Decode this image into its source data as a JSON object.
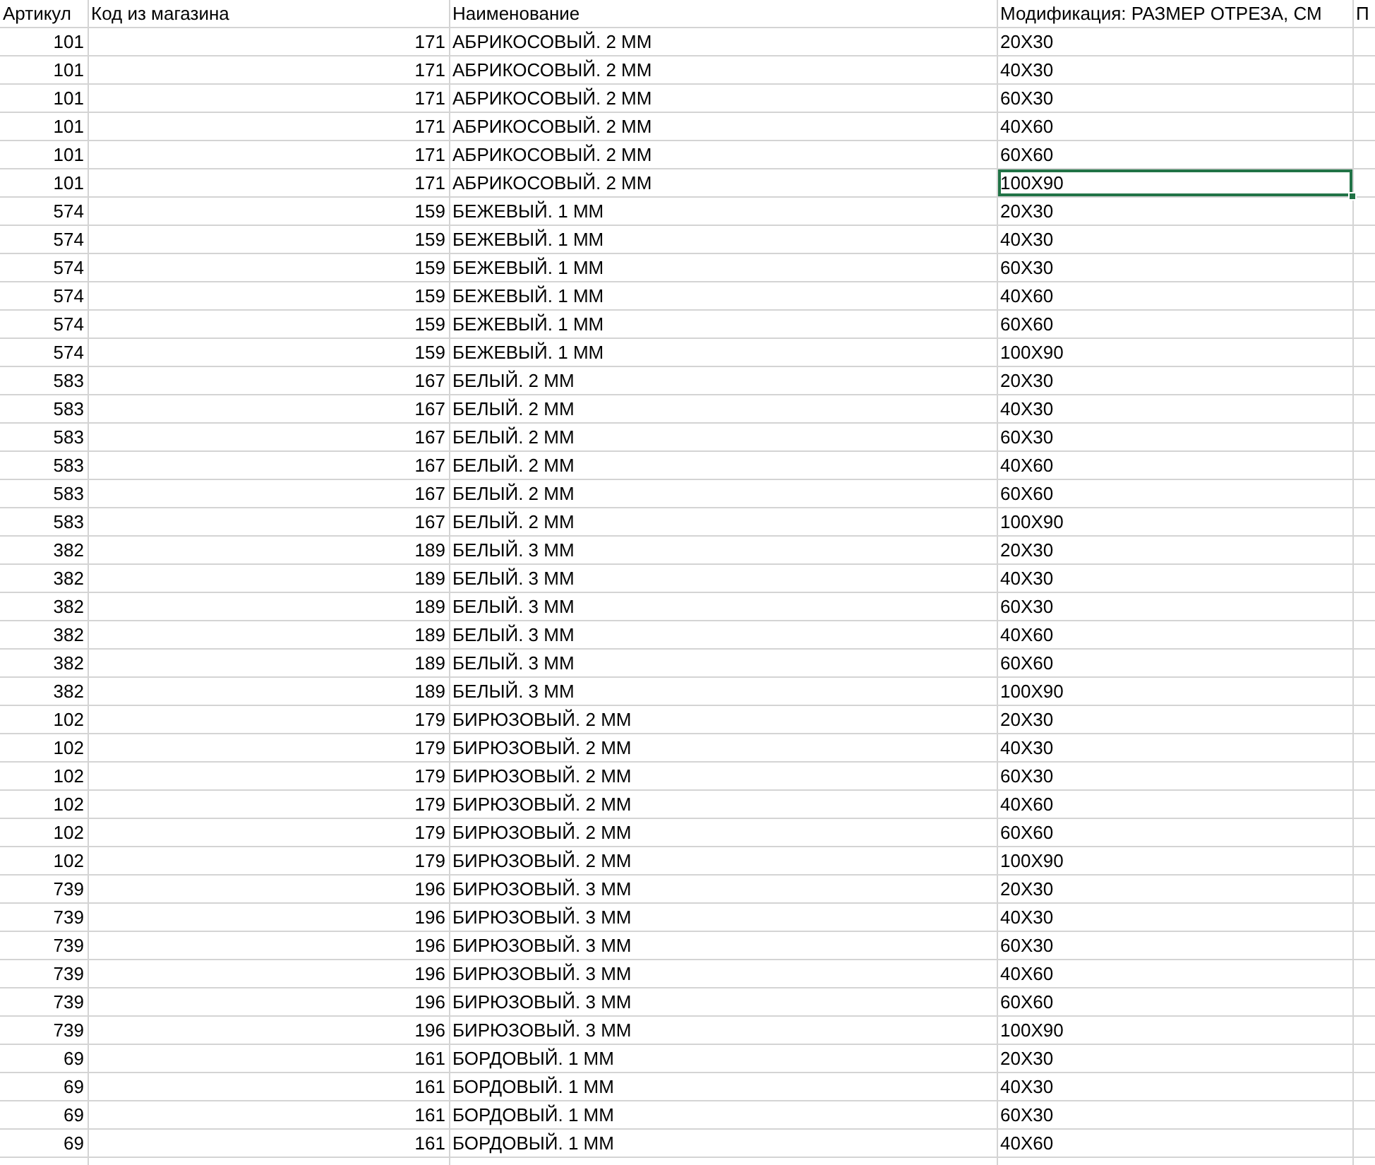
{
  "columns": [
    "Артикул",
    "Код из магазина",
    "Наименование",
    "Модификация: РАЗМЕР ОТРЕЗА, СМ",
    "П"
  ],
  "rows": [
    {
      "article": "101",
      "code": "171",
      "name": "АБРИКОСОВЫЙ. 2 ММ",
      "size": "20X30",
      "selected": false
    },
    {
      "article": "101",
      "code": "171",
      "name": "АБРИКОСОВЫЙ. 2 ММ",
      "size": "40X30",
      "selected": false
    },
    {
      "article": "101",
      "code": "171",
      "name": "АБРИКОСОВЫЙ. 2 ММ",
      "size": "60X30",
      "selected": false
    },
    {
      "article": "101",
      "code": "171",
      "name": "АБРИКОСОВЫЙ. 2 ММ",
      "size": "40X60",
      "selected": false
    },
    {
      "article": "101",
      "code": "171",
      "name": "АБРИКОСОВЫЙ. 2 ММ",
      "size": "60X60",
      "selected": false
    },
    {
      "article": "101",
      "code": "171",
      "name": "АБРИКОСОВЫЙ. 2 ММ",
      "size": "100X90",
      "selected": true
    },
    {
      "article": "574",
      "code": "159",
      "name": "БЕЖЕВЫЙ. 1 ММ",
      "size": "20X30",
      "selected": false
    },
    {
      "article": "574",
      "code": "159",
      "name": "БЕЖЕВЫЙ. 1 ММ",
      "size": "40X30",
      "selected": false
    },
    {
      "article": "574",
      "code": "159",
      "name": "БЕЖЕВЫЙ. 1 ММ",
      "size": "60X30",
      "selected": false
    },
    {
      "article": "574",
      "code": "159",
      "name": "БЕЖЕВЫЙ. 1 ММ",
      "size": "40X60",
      "selected": false
    },
    {
      "article": "574",
      "code": "159",
      "name": "БЕЖЕВЫЙ. 1 ММ",
      "size": "60X60",
      "selected": false
    },
    {
      "article": "574",
      "code": "159",
      "name": "БЕЖЕВЫЙ. 1 ММ",
      "size": "100X90",
      "selected": false
    },
    {
      "article": "583",
      "code": "167",
      "name": "БЕЛЫЙ. 2 ММ",
      "size": "20X30",
      "selected": false
    },
    {
      "article": "583",
      "code": "167",
      "name": "БЕЛЫЙ. 2 ММ",
      "size": "40X30",
      "selected": false
    },
    {
      "article": "583",
      "code": "167",
      "name": "БЕЛЫЙ. 2 ММ",
      "size": "60X30",
      "selected": false
    },
    {
      "article": "583",
      "code": "167",
      "name": "БЕЛЫЙ. 2 ММ",
      "size": "40X60",
      "selected": false
    },
    {
      "article": "583",
      "code": "167",
      "name": "БЕЛЫЙ. 2 ММ",
      "size": "60X60",
      "selected": false
    },
    {
      "article": "583",
      "code": "167",
      "name": "БЕЛЫЙ. 2 ММ",
      "size": "100X90",
      "selected": false
    },
    {
      "article": "382",
      "code": "189",
      "name": "БЕЛЫЙ. 3 ММ",
      "size": "20X30",
      "selected": false
    },
    {
      "article": "382",
      "code": "189",
      "name": "БЕЛЫЙ. 3 ММ",
      "size": "40X30",
      "selected": false
    },
    {
      "article": "382",
      "code": "189",
      "name": "БЕЛЫЙ. 3 ММ",
      "size": "60X30",
      "selected": false
    },
    {
      "article": "382",
      "code": "189",
      "name": "БЕЛЫЙ. 3 ММ",
      "size": "40X60",
      "selected": false
    },
    {
      "article": "382",
      "code": "189",
      "name": "БЕЛЫЙ. 3 ММ",
      "size": "60X60",
      "selected": false
    },
    {
      "article": "382",
      "code": "189",
      "name": "БЕЛЫЙ. 3 ММ",
      "size": "100X90",
      "selected": false
    },
    {
      "article": "102",
      "code": "179",
      "name": "БИРЮЗОВЫЙ. 2 ММ",
      "size": "20X30",
      "selected": false
    },
    {
      "article": "102",
      "code": "179",
      "name": "БИРЮЗОВЫЙ. 2 ММ",
      "size": "40X30",
      "selected": false
    },
    {
      "article": "102",
      "code": "179",
      "name": "БИРЮЗОВЫЙ. 2 ММ",
      "size": "60X30",
      "selected": false
    },
    {
      "article": "102",
      "code": "179",
      "name": "БИРЮЗОВЫЙ. 2 ММ",
      "size": "40X60",
      "selected": false
    },
    {
      "article": "102",
      "code": "179",
      "name": "БИРЮЗОВЫЙ. 2 ММ",
      "size": "60X60",
      "selected": false
    },
    {
      "article": "102",
      "code": "179",
      "name": "БИРЮЗОВЫЙ. 2 ММ",
      "size": "100X90",
      "selected": false
    },
    {
      "article": "739",
      "code": "196",
      "name": "БИРЮЗОВЫЙ. 3 ММ",
      "size": "20X30",
      "selected": false
    },
    {
      "article": "739",
      "code": "196",
      "name": "БИРЮЗОВЫЙ. 3 ММ",
      "size": "40X30",
      "selected": false
    },
    {
      "article": "739",
      "code": "196",
      "name": "БИРЮЗОВЫЙ. 3 ММ",
      "size": "60X30",
      "selected": false
    },
    {
      "article": "739",
      "code": "196",
      "name": "БИРЮЗОВЫЙ. 3 ММ",
      "size": "40X60",
      "selected": false
    },
    {
      "article": "739",
      "code": "196",
      "name": "БИРЮЗОВЫЙ. 3 ММ",
      "size": "60X60",
      "selected": false
    },
    {
      "article": "739",
      "code": "196",
      "name": "БИРЮЗОВЫЙ. 3 ММ",
      "size": "100X90",
      "selected": false
    },
    {
      "article": "69",
      "code": "161",
      "name": "БОРДОВЫЙ. 1 ММ",
      "size": "20X30",
      "selected": false
    },
    {
      "article": "69",
      "code": "161",
      "name": "БОРДОВЫЙ. 1 ММ",
      "size": "40X30",
      "selected": false
    },
    {
      "article": "69",
      "code": "161",
      "name": "БОРДОВЫЙ. 1 ММ",
      "size": "60X30",
      "selected": false
    },
    {
      "article": "69",
      "code": "161",
      "name": "БОРДОВЫЙ. 1 ММ",
      "size": "40X60",
      "selected": false
    }
  ]
}
